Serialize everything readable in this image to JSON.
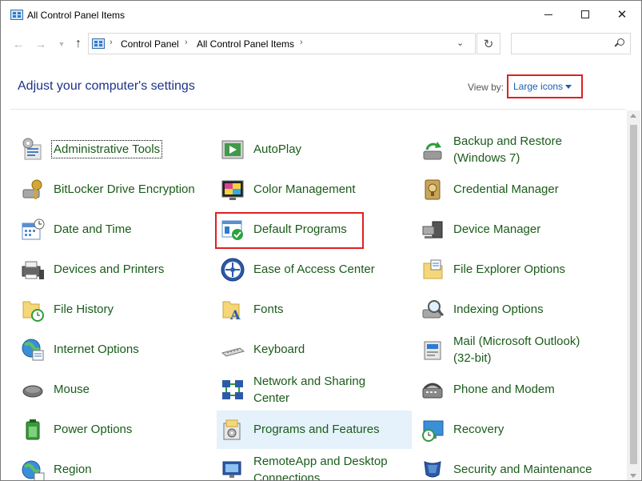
{
  "window": {
    "title": "All Control Panel Items",
    "controls": {
      "minimize": "minimize",
      "maximize": "maximize",
      "close": "close"
    }
  },
  "nav": {
    "breadcrumb": [
      "Control Panel",
      "All Control Panel Items"
    ],
    "search_placeholder": ""
  },
  "header": {
    "heading": "Adjust your computer's settings",
    "view_by_label": "View by:",
    "view_by_value": "Large icons"
  },
  "items": [
    {
      "label": "Administrative Tools",
      "icon": "admin-tools-icon"
    },
    {
      "label": "AutoPlay",
      "icon": "autoplay-icon"
    },
    {
      "label": "Backup and Restore (Windows 7)",
      "line1": "Backup and Restore",
      "line2": "(Windows 7)",
      "icon": "backup-restore-icon"
    },
    {
      "label": "BitLocker Drive Encryption",
      "icon": "bitlocker-icon"
    },
    {
      "label": "Color Management",
      "icon": "color-management-icon"
    },
    {
      "label": "Credential Manager",
      "icon": "credential-manager-icon"
    },
    {
      "label": "Date and Time",
      "icon": "date-time-icon"
    },
    {
      "label": "Default Programs",
      "icon": "default-programs-icon"
    },
    {
      "label": "Device Manager",
      "icon": "device-manager-icon"
    },
    {
      "label": "Devices and Printers",
      "icon": "devices-printers-icon"
    },
    {
      "label": "Ease of Access Center",
      "icon": "ease-of-access-icon"
    },
    {
      "label": "File Explorer Options",
      "icon": "file-explorer-options-icon"
    },
    {
      "label": "File History",
      "icon": "file-history-icon"
    },
    {
      "label": "Fonts",
      "icon": "fonts-icon"
    },
    {
      "label": "Indexing Options",
      "icon": "indexing-options-icon"
    },
    {
      "label": "Internet Options",
      "icon": "internet-options-icon"
    },
    {
      "label": "Keyboard",
      "icon": "keyboard-icon"
    },
    {
      "label": "Mail (Microsoft Outlook) (32-bit)",
      "line1": "Mail (Microsoft Outlook)",
      "line2": "(32-bit)",
      "icon": "mail-icon"
    },
    {
      "label": "Mouse",
      "icon": "mouse-icon"
    },
    {
      "label": "Network and Sharing Center",
      "line1": "Network and Sharing",
      "line2": "Center",
      "icon": "network-sharing-icon"
    },
    {
      "label": "Phone and Modem",
      "icon": "phone-modem-icon"
    },
    {
      "label": "Power Options",
      "icon": "power-options-icon"
    },
    {
      "label": "Programs and Features",
      "icon": "programs-features-icon"
    },
    {
      "label": "Recovery",
      "icon": "recovery-icon"
    },
    {
      "label": "Region",
      "icon": "region-icon"
    },
    {
      "label": "RemoteApp and Desktop Connections",
      "line1": "RemoteApp and Desktop",
      "line2": "Connections",
      "icon": "remoteapp-icon"
    },
    {
      "label": "Security and Maintenance",
      "icon": "security-maintenance-icon"
    }
  ],
  "colors": {
    "link_green": "#1a5c1a",
    "heading_blue": "#1e3287",
    "accent_blue": "#1a5fb4",
    "highlight_red": "#e02020",
    "hover_bg": "#e5f1fb"
  }
}
